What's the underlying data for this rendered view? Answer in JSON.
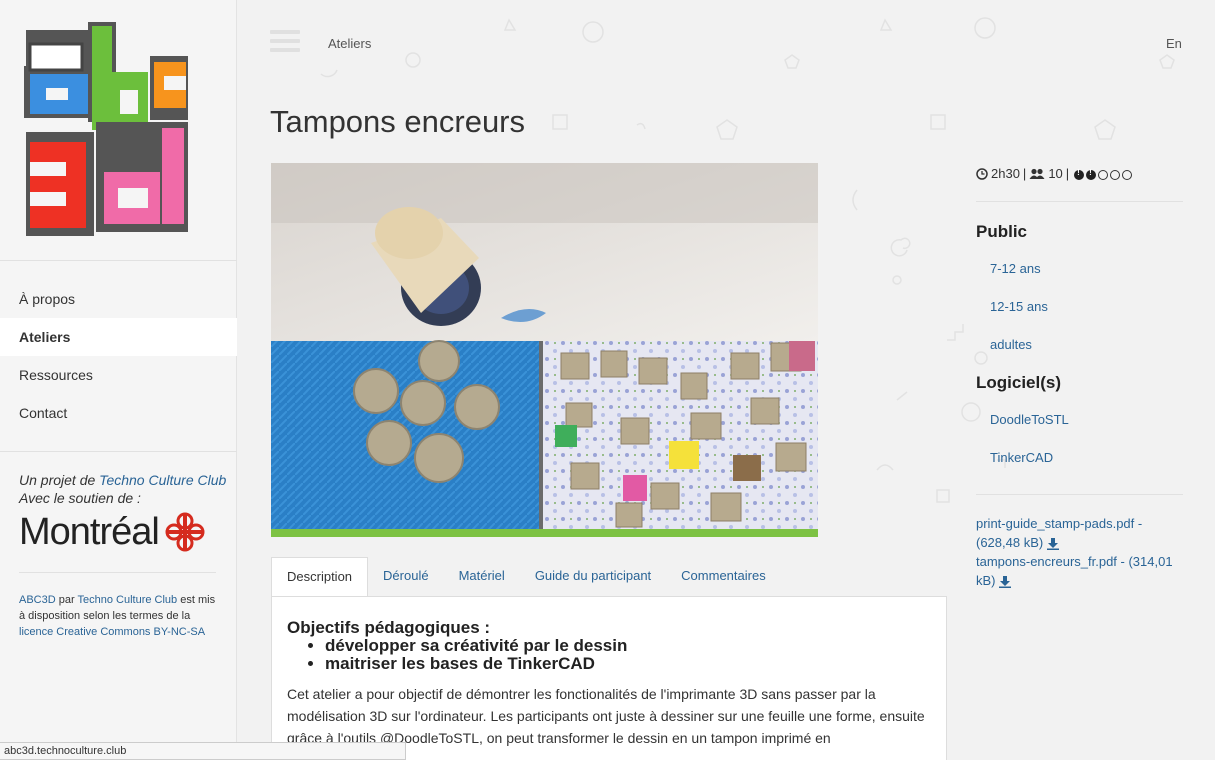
{
  "sidebar": {
    "nav": [
      {
        "label": "À propos"
      },
      {
        "label": "Ateliers"
      },
      {
        "label": "Ressources"
      },
      {
        "label": "Contact"
      }
    ],
    "project_prefix": "Un projet de ",
    "project_link": "Techno Culture Club",
    "support_text": "Avec le soutien de :",
    "montreal_text": "Montréal",
    "license_abc3d": "ABC3D",
    "license_par": " par ",
    "license_tcc": "Techno Culture Club",
    "license_mid": " est mis à disposition selon les termes de la ",
    "license_link": "licence Creative Commons BY-NC-SA"
  },
  "header": {
    "breadcrumb": "Ateliers",
    "lang": "En"
  },
  "page": {
    "title": "Tampons encreurs"
  },
  "tabs": [
    {
      "label": "Description"
    },
    {
      "label": "Déroulé"
    },
    {
      "label": "Matériel"
    },
    {
      "label": "Guide du participant"
    },
    {
      "label": "Commentaires"
    }
  ],
  "description": {
    "objectives_title": "Objectifs pédagogiques :",
    "objectives": [
      "développer sa créativité par le dessin",
      "maitriser les bases de TinkerCAD"
    ],
    "text": "Cet atelier a pour objectif de démontrer les fonctionalités de l'imprimante 3D sans passer par la modélisation 3D sur l'ordinateur. Les participants ont juste à dessiner sur une feuille une forme, ensuite grâce à l'outils @DoodleToSTL, on peut transformer le dessin en un tampon imprimé en"
  },
  "meta": {
    "duration": "2h30",
    "participants": "10",
    "separator": "|",
    "difficulty_level": 2,
    "difficulty_max": 5
  },
  "public": {
    "heading": "Public",
    "items": [
      "7-12 ans",
      "12-15 ans",
      "adultes"
    ]
  },
  "software": {
    "heading": "Logiciel(s)",
    "items": [
      "DoodleToSTL",
      "TinkerCAD"
    ]
  },
  "downloads": [
    {
      "label": "print-guide_stamp-pads.pdf - (628,48 kB)"
    },
    {
      "label": "tampons-encreurs_fr.pdf - (314,01 kB)"
    }
  ],
  "status_bar": "abc3d.technoculture.club",
  "colors": {
    "link": "#2a6496",
    "accent_green": "#7dc243",
    "logo_blue": "#3b8fe0",
    "logo_green": "#6cbf3c",
    "logo_orange": "#f7941d",
    "logo_red": "#ee3124",
    "logo_pink": "#f06ba8",
    "montreal_red": "#d52b1e"
  }
}
